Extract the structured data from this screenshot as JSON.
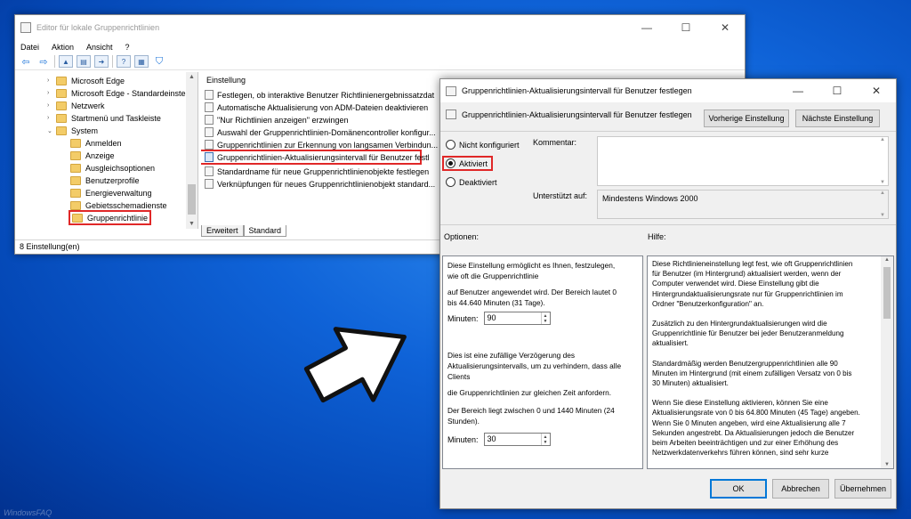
{
  "watermark": "WindowsFAQ",
  "editor": {
    "title": "Editor für lokale Gruppenrichtlinien",
    "menu": [
      "Datei",
      "Aktion",
      "Ansicht",
      "?"
    ],
    "tree": [
      {
        "label": "Microsoft Edge",
        "chevron": "›"
      },
      {
        "label": "Microsoft Edge - Standardeinste",
        "chevron": "›"
      },
      {
        "label": "Netzwerk",
        "chevron": "›"
      },
      {
        "label": "Startmenü und Taskleiste",
        "chevron": "›"
      },
      {
        "label": "System",
        "chevron": "⌄"
      },
      {
        "label": "Anmelden",
        "chevron": ""
      },
      {
        "label": "Anzeige",
        "chevron": ""
      },
      {
        "label": "Ausgleichsoptionen",
        "chevron": ""
      },
      {
        "label": "Benutzerprofile",
        "chevron": ""
      },
      {
        "label": "Energieverwaltung",
        "chevron": ""
      },
      {
        "label": "Gebietsschemadienste",
        "chevron": ""
      },
      {
        "label": "Gruppenrichtlinie",
        "chevron": ""
      }
    ],
    "list_header": "Einstellung",
    "settings": [
      "Festlegen, ob interaktive Benutzer Richtlinienergebnissatzdat",
      "Automatische Aktualisierung von ADM-Dateien deaktivieren",
      "\"Nur Richtlinien anzeigen\" erzwingen",
      "Auswahl der Gruppenrichtlinien-Domänencontroller konfigur...",
      "Gruppenrichtlinien zur Erkennung von langsamen Verbindun...",
      "Gruppenrichtlinien-Aktualisierungsintervall für Benutzer festl",
      "Standardname für neue Gruppenrichtlinienobjekte festlegen",
      "Verknüpfungen für neues Gruppenrichtlinienobjekt standard..."
    ],
    "tabs": [
      "Erweitert",
      "Standard"
    ],
    "status": "8 Einstellung(en)"
  },
  "dialog": {
    "title": "Gruppenrichtlinien-Aktualisierungsintervall für Benutzer festlegen",
    "header_text": "Gruppenrichtlinien-Aktualisierungsintervall für Benutzer festlegen",
    "prev_button": "Vorherige Einstellung",
    "next_button": "Nächste Einstellung",
    "radio_not_configured": "Nicht konfiguriert",
    "radio_enabled": "Aktiviert",
    "radio_disabled": "Deaktiviert",
    "comment_label": "Kommentar:",
    "supported_label": "Unterstützt auf:",
    "supported_value": "Mindestens Windows 2000",
    "options_label": "Optionen:",
    "help_label": "Hilfe:",
    "options": {
      "line1": "Diese Einstellung ermöglicht es Ihnen, festzulegen,",
      "line2": "wie oft die Gruppenrichtlinie",
      "line3": "auf Benutzer angewendet wird. Der Bereich lautet 0",
      "line4": "bis 44.640 Minuten (31 Tage).",
      "minutes_label": "Minuten:",
      "minutes_value": "90",
      "line5": "Dies ist eine zufällige Verzögerung des",
      "line6": "Aktualisierungsintervalls, um zu verhindern, dass alle",
      "line7": "Clients",
      "line8": "die Gruppenrichtlinien zur gleichen Zeit anfordern.",
      "line9": "Der Bereich liegt zwischen 0 und 1440 Minuten (24",
      "line10": "Stunden).",
      "minutes2_label": "Minuten:",
      "minutes2_value": "30"
    },
    "help": [
      "Diese Richtlinieneinstellung legt fest, wie oft Gruppenrichtlinien",
      "für Benutzer (im Hintergrund) aktualisiert werden, wenn der",
      "Computer verwendet wird. Diese Einstellung gibt die",
      "Hintergrundaktualisierungsrate nur für Gruppenrichtlinien im",
      "Ordner \"Benutzerkonfiguration\" an.",
      "",
      "Zusätzlich zu den Hintergrundaktualisierungen wird die",
      "Gruppenrichtlinie für Benutzer bei jeder Benutzeranmeldung",
      "aktualisiert.",
      "",
      "Standardmäßig werden Benutzergruppenrichtlinien alle 90",
      "Minuten im Hintergrund (mit einem zufälligen Versatz von 0 bis",
      "30 Minuten) aktualisiert.",
      "",
      "Wenn Sie diese Einstellung aktivieren, können Sie eine",
      "Aktualisierungsrate von 0 bis 64.800 Minuten (45 Tage) angeben.",
      "Wenn Sie 0 Minuten angeben, wird eine Aktualisierung alle 7",
      "Sekunden angestrebt. Da Aktualisierungen jedoch die Benutzer",
      "beim Arbeiten beeinträchtigen und zur einer Erhöhung des",
      "Netzwerkdatenverkehrs führen können, sind sehr kurze"
    ],
    "ok": "OK",
    "cancel": "Abbrechen",
    "apply": "Übernehmen"
  }
}
